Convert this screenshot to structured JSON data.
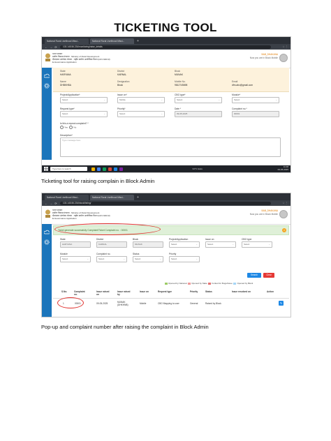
{
  "document": {
    "title": "TICKETING TOOL",
    "caption1": "Ticketing tool for raising complain in Block Admin",
    "caption2": "Pop-up and complaint number after raising the complaint in Block Admin"
  },
  "browser": {
    "tab1": "National Rural Livelihood Missi...",
    "tab2": "National Rural Livelihood Missi...",
    "url1": "103.145.56.234/monitoring/raise_details",
    "url2": "103.145.56.234/block/listing/"
  },
  "header": {
    "line1": "भारत सरकार",
    "line2": "ग्रामीण विकास मंत्रालय · Ministry of Rural Development",
    "line3": "दीनदयाल अंत्योदय योजना · राष्ट्रीय ग्रामीण आजीविका मिशन (DAY-NRLM)",
    "line4": "E-Governance Application",
    "username": "BAB_DHAKANA",
    "role": "Now you are in Block Mobile"
  },
  "info": {
    "state_label": "State",
    "state": "HARYANA",
    "district_label": "District",
    "district": "KARNAL",
    "block_label": "Block",
    "block": "MUNAK",
    "name_label": "Name",
    "name": "DHBKHBA",
    "designation_label": "Designation",
    "designation": "Block",
    "mobile_label": "Mobile No.",
    "mobile": "9812745698",
    "email_label": "Email",
    "email": "dfm.abc@gmail.com"
  },
  "form": {
    "project_label": "Project/Application*",
    "project_value": "Select",
    "issue_label": "Issue on*",
    "issue_value": "Mobile",
    "cbo_label": "CBO type*",
    "cbo_value": "Select",
    "module_label": "Module*",
    "module_value": "Select",
    "request_label": "Request type*",
    "request_value": "Select",
    "priority_label": "Priority*",
    "priority_value": "Select",
    "date_label": "Date *",
    "date_value": "09-05-2025",
    "complaint_label": "Complaint no.*",
    "complaint_value": "00001",
    "repeat_label": "Is this a repeat complaint? *",
    "yes": "Yes",
    "no": "No",
    "desc_label": "Description*",
    "desc_placeholder": "Type message here"
  },
  "taskbar": {
    "search": "Type here to search",
    "weather": "34°C Haze",
    "time": "11:08",
    "date": "09-05-2025"
  },
  "shot2": {
    "alert": "Ticket generate successfully Complaint/Ticket Complaint no. : 00001",
    "filters": [
      {
        "label": "State",
        "value": "HARYANA"
      },
      {
        "label": "District",
        "value": "KARNAL"
      },
      {
        "label": "Block",
        "value": "MUNAK"
      },
      {
        "label": "Project/Application",
        "value": "Select"
      },
      {
        "label": "Issue on",
        "value": "Select"
      },
      {
        "label": "CBO type",
        "value": "Select"
      }
    ],
    "filters2": [
      {
        "label": "Module",
        "value": "Select"
      },
      {
        "label": "Complaint no.",
        "value": "Select"
      },
      {
        "label": "Status",
        "value": "Select"
      },
      {
        "label": "Priority",
        "value": "Select"
      }
    ],
    "search_btn": "Search",
    "clear_btn": "Clear",
    "legend": [
      {
        "label": "Opened by National",
        "color": "#9ccc65"
      },
      {
        "label": "Opened by State",
        "color": "#ef9a9a"
      },
      {
        "label": "Forked for Bugs/Issue",
        "color": "#e57373"
      },
      {
        "label": "Opened by Block",
        "color": "#a5d6f7"
      }
    ],
    "headers": [
      "S.No.",
      "Complaint no.",
      "Issue raised on",
      "Issue raised by",
      "Issue on",
      "Request type",
      "Priority",
      "Status",
      "Issue resolved on",
      "Action"
    ],
    "row": [
      "1",
      "00001",
      "09-05-2025",
      "MUNAK (DHKHNB)",
      "Mobile",
      "CBO Mapping to user",
      "General",
      "Raised by Block",
      "",
      ""
    ]
  }
}
